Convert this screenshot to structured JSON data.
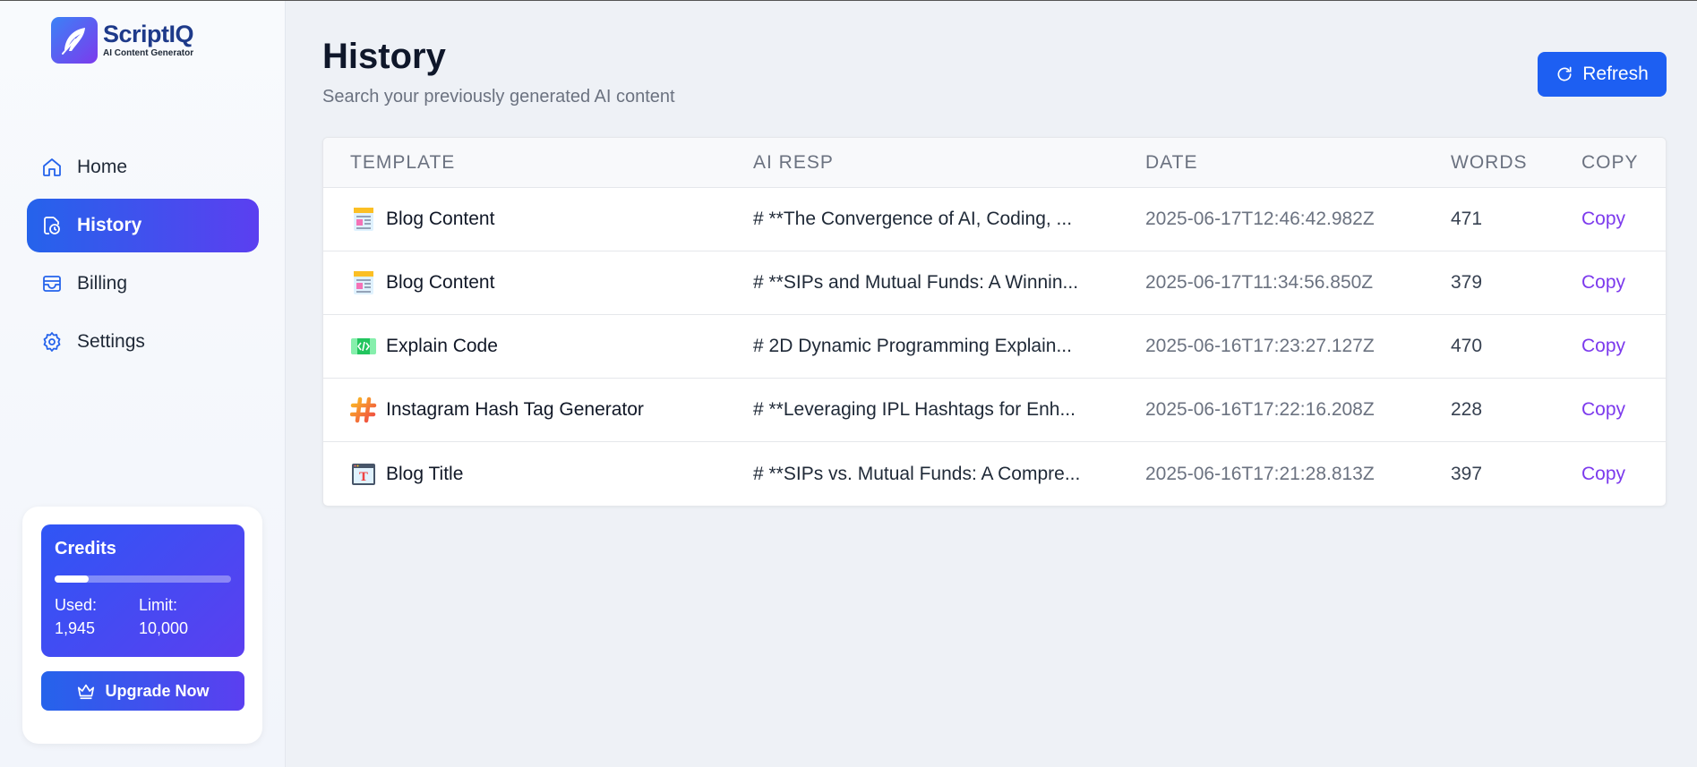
{
  "brand": {
    "name": "ScriptIQ",
    "tagline": "AI Content Generator",
    "logo_icon": "feather-icon"
  },
  "nav": {
    "items": [
      {
        "label": "Home",
        "icon": "home-icon",
        "active": false
      },
      {
        "label": "History",
        "icon": "history-icon",
        "active": true
      },
      {
        "label": "Billing",
        "icon": "wallet-icon",
        "active": false
      },
      {
        "label": "Settings",
        "icon": "gear-icon",
        "active": false
      }
    ]
  },
  "credits": {
    "title": "Credits",
    "used_label": "Used:",
    "used_value": "1,945",
    "limit_label": "Limit:",
    "limit_value": "10,000",
    "fraction_used": 0.1945,
    "upgrade_label": "Upgrade Now"
  },
  "header": {
    "title": "History",
    "subtitle": "Search your previously generated AI content",
    "refresh_label": "Refresh"
  },
  "table": {
    "columns": [
      "TEMPLATE",
      "AI RESP",
      "DATE",
      "WORDS",
      "COPY"
    ],
    "rows": [
      {
        "template": "Blog Content",
        "icon": "blog-doc-icon",
        "response": "# **The Convergence of AI, Coding, ...",
        "date": "2025-06-17T12:46:42.982Z",
        "words": "471",
        "copy": "Copy"
      },
      {
        "template": "Blog Content",
        "icon": "blog-doc-icon",
        "response": "# **SIPs and Mutual Funds: A Winnin...",
        "date": "2025-06-17T11:34:56.850Z",
        "words": "379",
        "copy": "Copy"
      },
      {
        "template": "Explain Code",
        "icon": "code-icon",
        "response": "# 2D Dynamic Programming Explain...",
        "date": "2025-06-16T17:23:27.127Z",
        "words": "470",
        "copy": "Copy"
      },
      {
        "template": "Instagram Hash Tag Generator",
        "icon": "hashtag-icon",
        "response": "# **Leveraging IPL Hashtags for Enh...",
        "date": "2025-06-16T17:22:16.208Z",
        "words": "228",
        "copy": "Copy"
      },
      {
        "template": "Blog Title",
        "icon": "title-window-icon",
        "response": "# **SIPs vs. Mutual Funds: A Compre...",
        "date": "2025-06-16T17:21:28.813Z",
        "words": "397",
        "copy": "Copy"
      }
    ]
  },
  "colors": {
    "accent": "#1d5ff2",
    "accent_gradient_end": "#5b3ff0",
    "copy_link": "#7c3aed",
    "background": "#eef1f6"
  }
}
